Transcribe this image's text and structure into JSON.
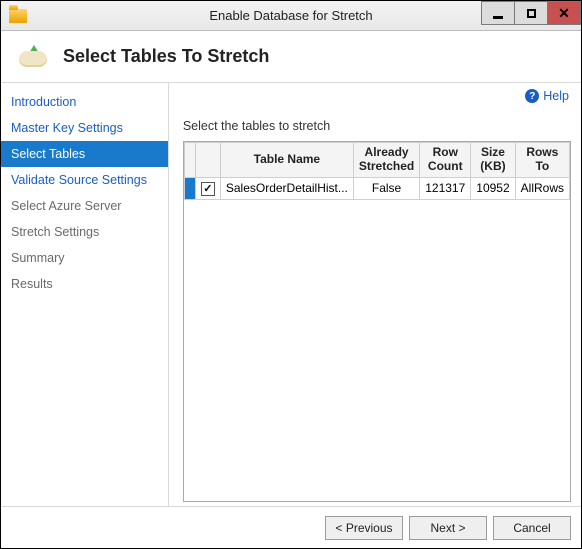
{
  "window": {
    "title": "Enable Database for Stretch"
  },
  "header": {
    "title": "Select Tables To Stretch"
  },
  "help": {
    "label": "Help"
  },
  "sidebar": {
    "items": [
      {
        "label": "Introduction",
        "state": "link"
      },
      {
        "label": "Master Key Settings",
        "state": "link"
      },
      {
        "label": "Select Tables",
        "state": "selected"
      },
      {
        "label": "Validate Source Settings",
        "state": "link"
      },
      {
        "label": "Select Azure Server",
        "state": "disabled"
      },
      {
        "label": "Stretch Settings",
        "state": "disabled"
      },
      {
        "label": "Summary",
        "state": "disabled"
      },
      {
        "label": "Results",
        "state": "disabled"
      }
    ]
  },
  "main": {
    "instruction": "Select the tables to stretch",
    "columns": {
      "table_name": "Table Name",
      "already_stretched": "Already Stretched",
      "row_count": "Row Count",
      "size_kb": "Size (KB)",
      "rows_to": "Rows To"
    },
    "rows": [
      {
        "selected": true,
        "checked": true,
        "table_name": "SalesOrderDetailHist...",
        "already_stretched": "False",
        "row_count": "121317",
        "size_kb": "10952",
        "rows_to": "AllRows"
      }
    ]
  },
  "footer": {
    "previous": "< Previous",
    "next": "Next >",
    "cancel": "Cancel"
  }
}
